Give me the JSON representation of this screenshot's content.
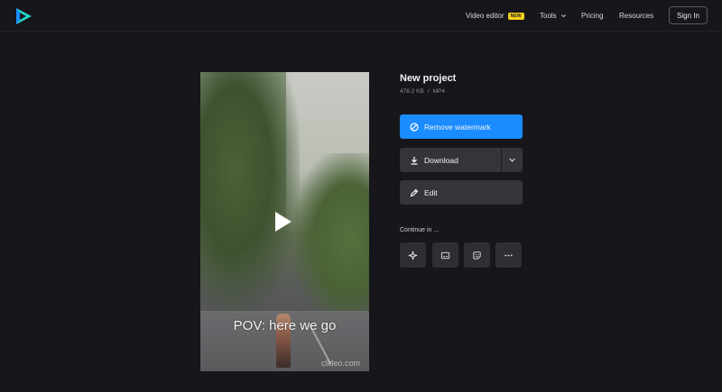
{
  "nav": {
    "video_editor": "Video editor",
    "new_badge": "NEW",
    "tools": "Tools",
    "pricing": "Pricing",
    "resources": "Resources",
    "sign_in": "Sign In"
  },
  "project": {
    "title": "New project",
    "size": "476.2 KB",
    "separator": "/",
    "format": "MP4"
  },
  "video": {
    "caption": "POV: here we go",
    "watermark": "clideo.com"
  },
  "actions": {
    "remove_watermark": "Remove watermark",
    "download": "Download",
    "edit": "Edit"
  },
  "continue": {
    "label": "Continue in ...",
    "tools": [
      {
        "icon": "sparkle-icon"
      },
      {
        "icon": "subtitles-icon"
      },
      {
        "icon": "sticker-icon"
      },
      {
        "icon": "more-icon"
      }
    ]
  },
  "colors": {
    "background": "#17161b",
    "accent": "#1a8cff",
    "button": "#35343b",
    "badge": "#f6d21a",
    "logo_blue": "#1a8cff",
    "logo_teal": "#23d6c9"
  }
}
